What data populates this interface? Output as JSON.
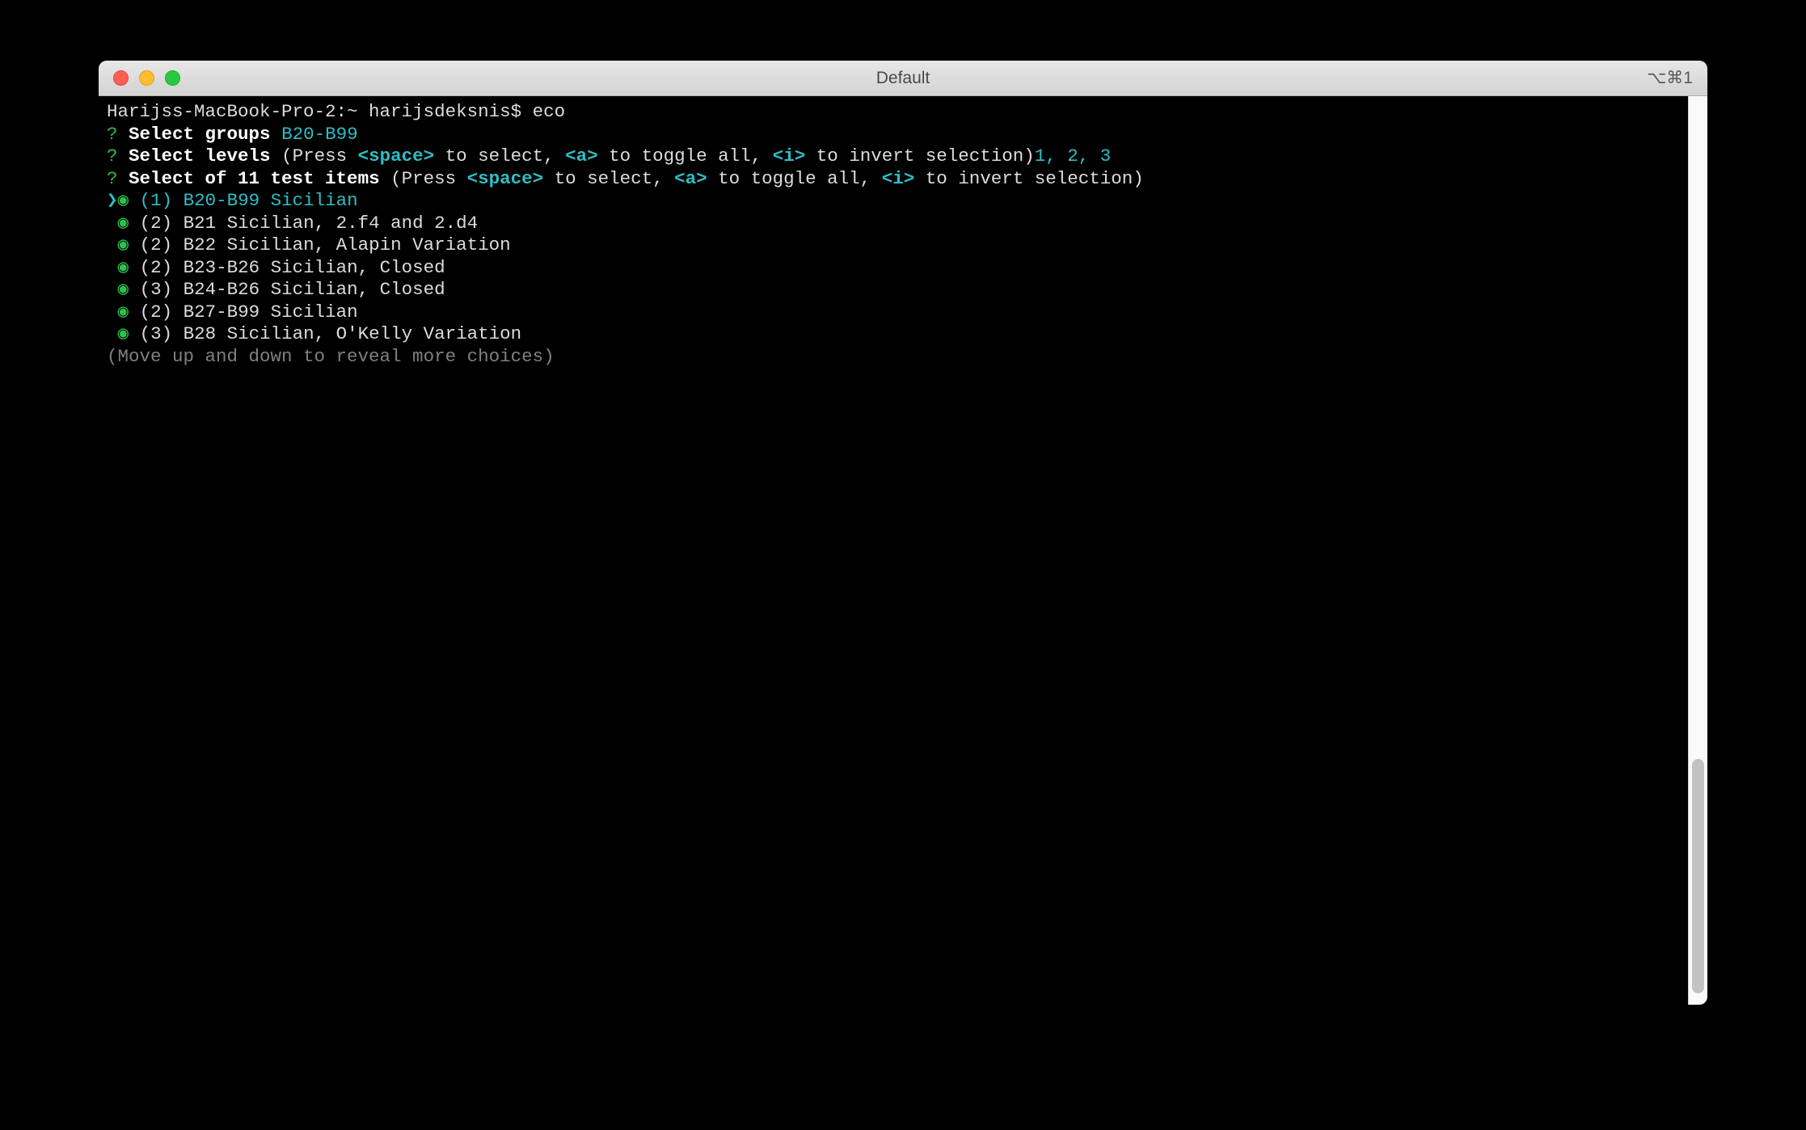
{
  "window": {
    "title": "Default",
    "shortcut": "⌥⌘1"
  },
  "prompt": {
    "host": "Harijss-MacBook-Pro-2:~ harijsdeksnis$ ",
    "command": "eco"
  },
  "lines": {
    "q1_mark": "?",
    "q1_label": " Select groups ",
    "q1_answer": "B20-B99",
    "q2_mark": "?",
    "q2_label": " Select levels ",
    "q2_hint_pre": "(Press ",
    "q2_key_space": "<space>",
    "q2_hint_mid1": " to select, ",
    "q2_key_a": "<a>",
    "q2_hint_mid2": " to toggle all, ",
    "q2_key_i": "<i>",
    "q2_hint_post": " to invert selection)",
    "q2_answer": "1, 2, 3",
    "q3_mark": "?",
    "q3_label": " Select of 11 test items ",
    "q3_hint_pre": "(Press ",
    "q3_key_space": "<space>",
    "q3_hint_mid1": " to select, ",
    "q3_key_a": "<a>",
    "q3_hint_mid2": " to toggle all, ",
    "q3_key_i": "<i>",
    "q3_hint_post": " to invert selection)"
  },
  "items": {
    "cursor": "❯",
    "bullet": "◉",
    "i0": " (1) B20-B99 Sicilian",
    "i1": " (2) B21 Sicilian, 2.f4 and 2.d4",
    "i2": " (2) B22 Sicilian, Alapin Variation",
    "i3": " (2) B23-B26 Sicilian, Closed",
    "i4": " (3) B24-B26 Sicilian, Closed",
    "i5": " (2) B27-B99 Sicilian",
    "i6": " (3) B28 Sicilian, O'Kelly Variation"
  },
  "footer": "(Move up and down to reveal more choices)"
}
